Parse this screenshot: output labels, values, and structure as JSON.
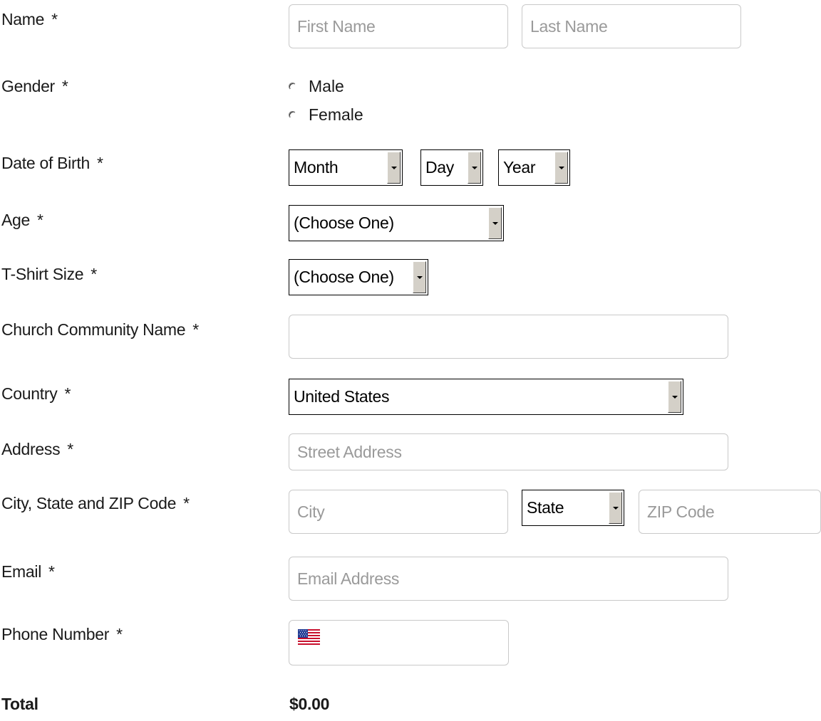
{
  "fields": {
    "name": {
      "label": "Name",
      "required": "*",
      "first_placeholder": "First Name",
      "last_placeholder": "Last Name"
    },
    "gender": {
      "label": "Gender",
      "required": "*",
      "options": [
        "Male",
        "Female"
      ]
    },
    "dob": {
      "label": "Date of Birth",
      "required": "*",
      "month": "Month",
      "day": "Day",
      "year": "Year"
    },
    "age": {
      "label": "Age",
      "required": "*",
      "selected": "(Choose One)"
    },
    "tshirt": {
      "label": "T-Shirt Size",
      "required": "*",
      "selected": "(Choose One)"
    },
    "church": {
      "label": "Church Community Name",
      "required": "*",
      "value": ""
    },
    "country": {
      "label": "Country",
      "required": "*",
      "selected": "United States"
    },
    "address": {
      "label": "Address",
      "required": "*",
      "placeholder": "Street Address"
    },
    "city_state_zip": {
      "label": "City, State and ZIP Code",
      "required": "*",
      "city_placeholder": "City",
      "state": "State",
      "zip_placeholder": "ZIP Code"
    },
    "email": {
      "label": "Email",
      "required": "*",
      "placeholder": "Email Address"
    },
    "phone": {
      "label": "Phone Number",
      "required": "*",
      "flag_icon": "us-flag-icon",
      "value": ""
    }
  },
  "total": {
    "label": "Total",
    "value": "$0.00"
  }
}
